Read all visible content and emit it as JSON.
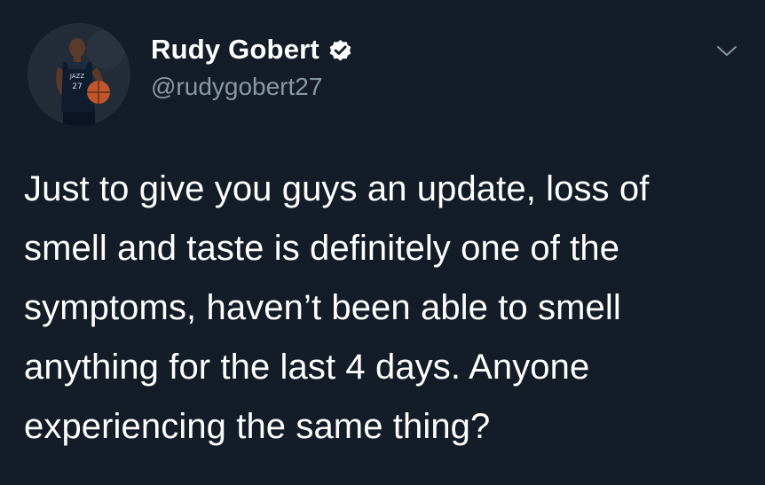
{
  "tweet": {
    "author": {
      "display_name": "Rudy Gobert",
      "handle": "@rudygobert27",
      "verified": true,
      "avatar_icon": "profile-photo"
    },
    "body_lines": [
      "Just to give you guys an update, loss of",
      "smell and taste is definitely one of the",
      "symptoms, haven’t been able to smell",
      "anything for the last 4 days. Anyone",
      "experiencing the same thing?"
    ],
    "menu_icon": "chevron-down-icon"
  },
  "colors": {
    "background": "#141c27",
    "text_primary": "#ffffff",
    "text_secondary": "#8899a6",
    "verified_badge": "#ffffff"
  }
}
